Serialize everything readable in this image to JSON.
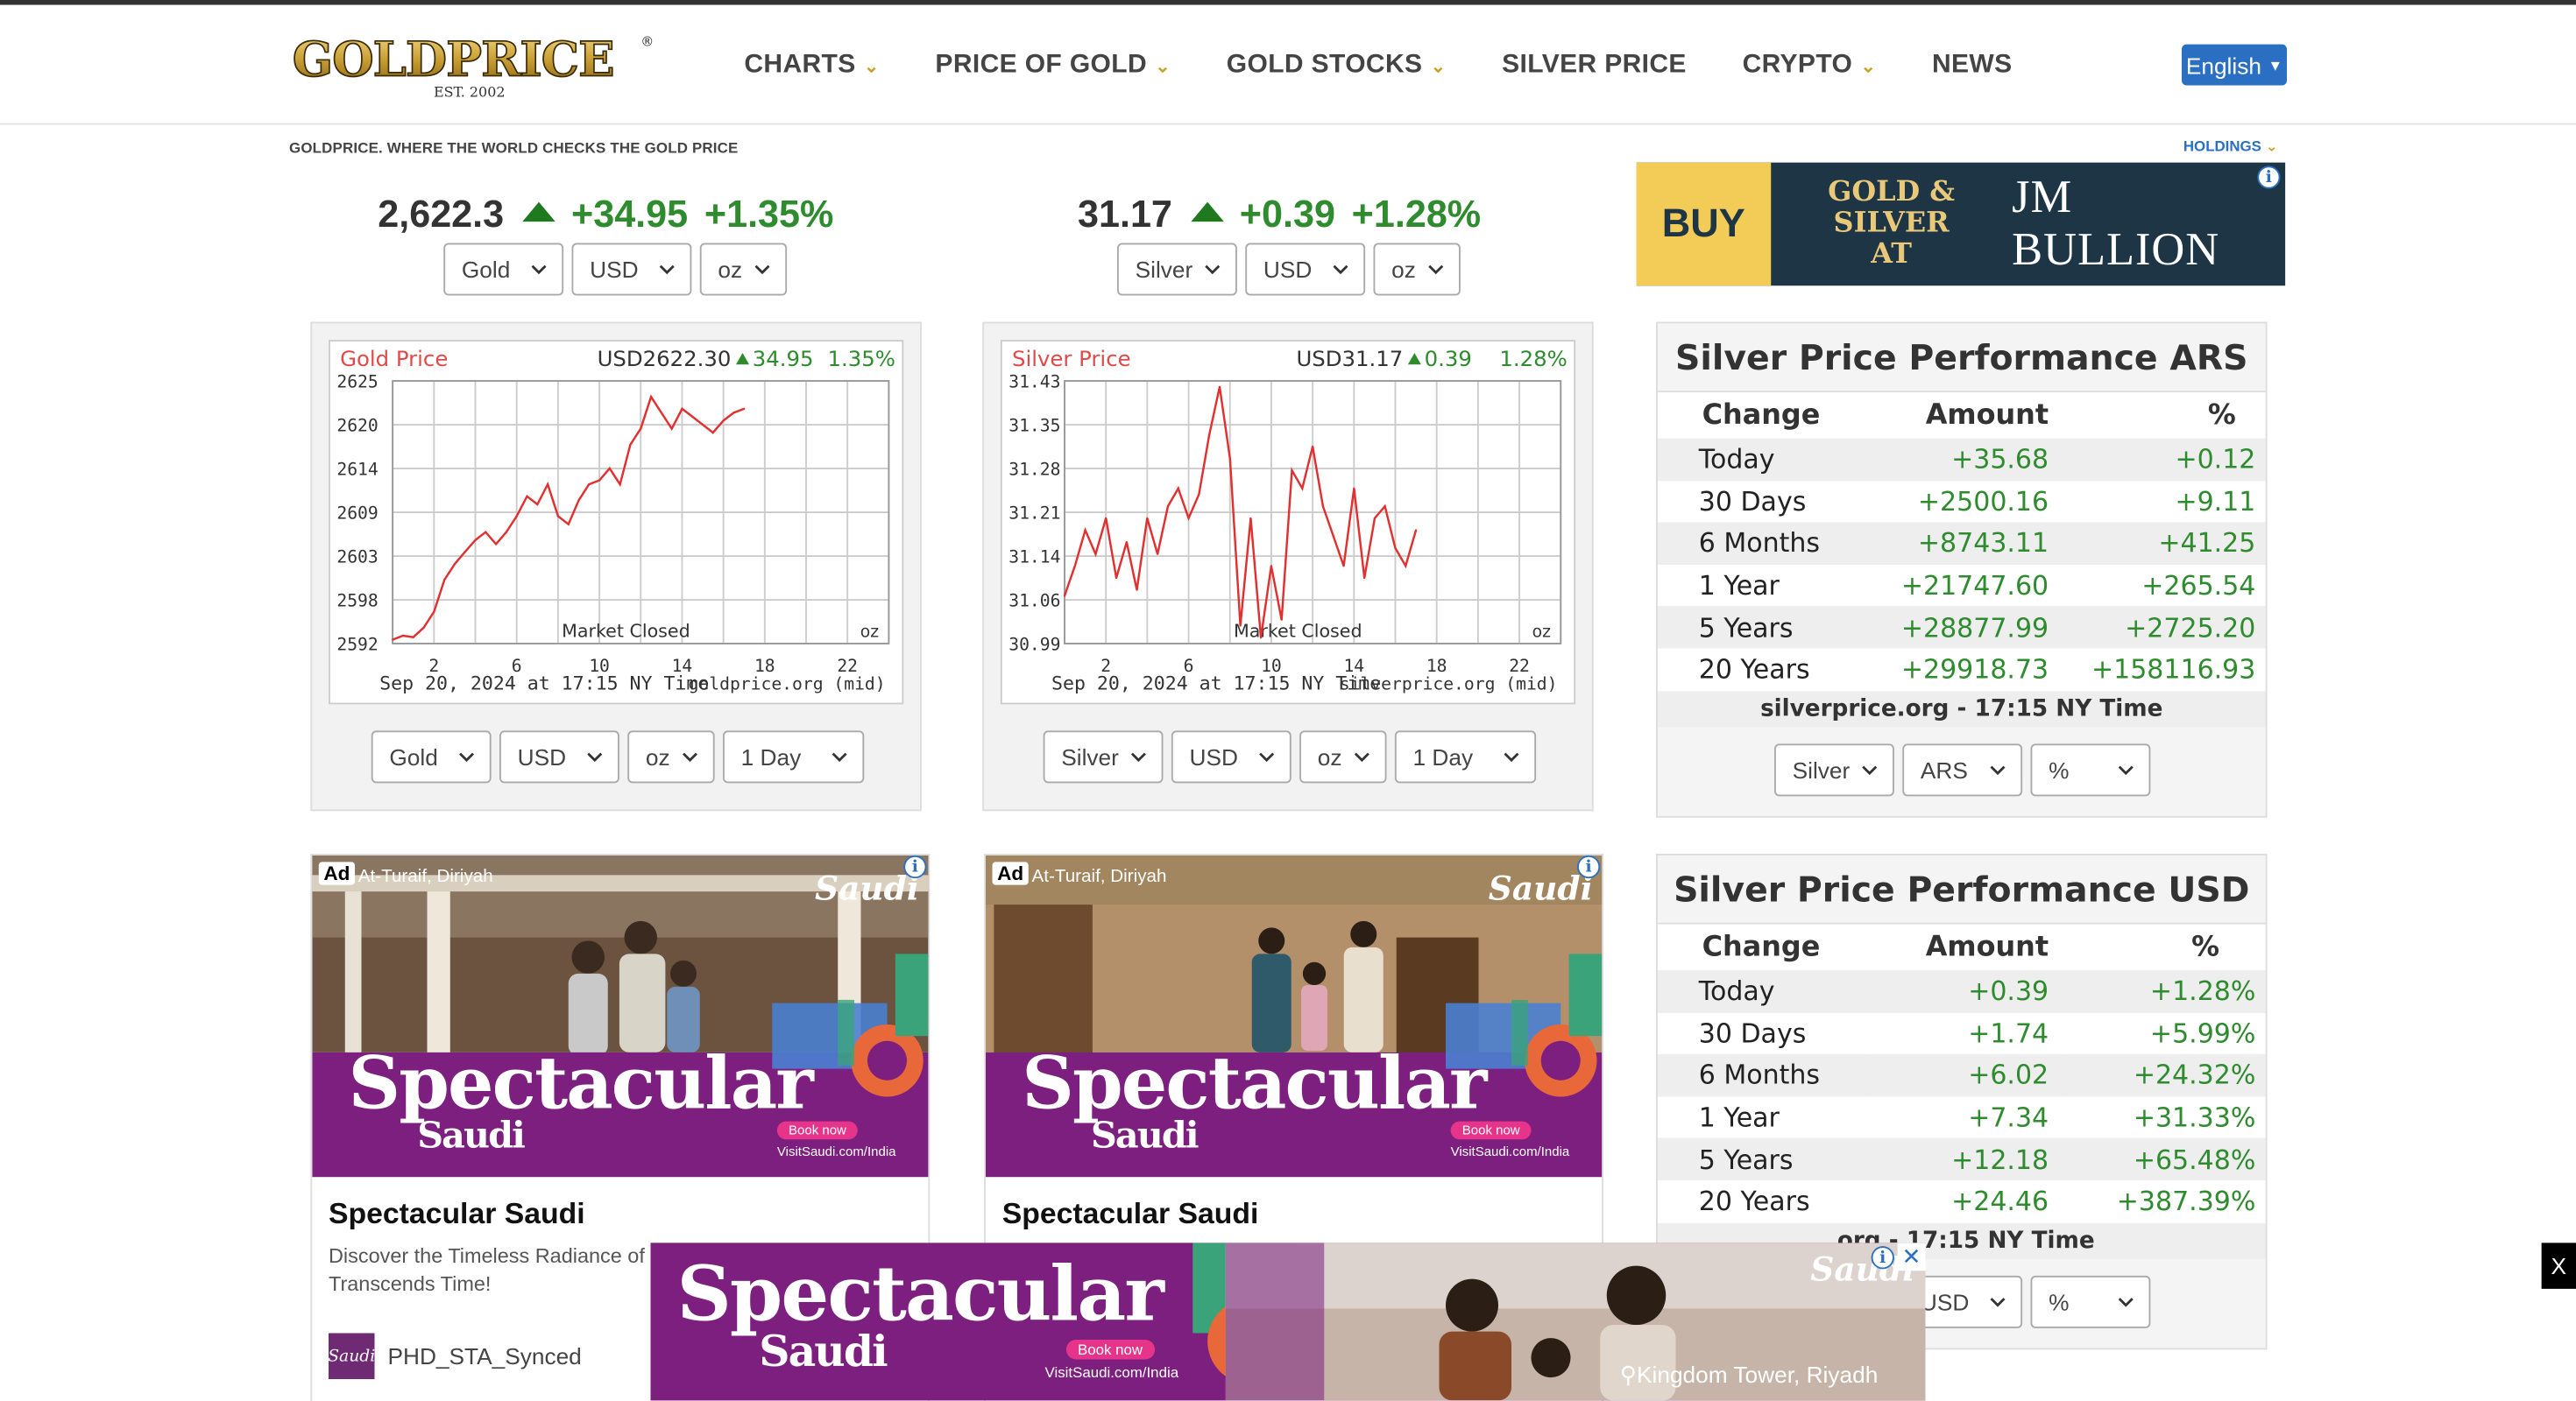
{
  "header": {
    "logo_text": "GOLDPRICE",
    "logo_est": "EST. 2002",
    "nav": [
      {
        "label": "CHARTS",
        "dropdown": true
      },
      {
        "label": "PRICE OF GOLD",
        "dropdown": true
      },
      {
        "label": "GOLD STOCKS",
        "dropdown": true
      },
      {
        "label": "SILVER PRICE",
        "dropdown": false
      },
      {
        "label": "CRYPTO",
        "dropdown": true
      },
      {
        "label": "NEWS",
        "dropdown": false
      }
    ],
    "language": "English",
    "tagline": "GOLDPRICE. WHERE THE WORLD CHECKS THE GOLD PRICE",
    "holdings": "HOLDINGS"
  },
  "gold_ticker": {
    "price": "2,622.3",
    "change": "+34.95",
    "percent": "+1.35%",
    "selects": [
      "Gold",
      "USD",
      "oz"
    ]
  },
  "silver_ticker": {
    "price": "31.17",
    "change": "+0.39",
    "percent": "+1.28%",
    "selects": [
      "Silver",
      "USD",
      "oz"
    ]
  },
  "top_ad": {
    "buy": "BUY",
    "line1": "GOLD &",
    "line2": "SILVER AT",
    "brand": "JM BULLION"
  },
  "gold_chart": {
    "title": "Gold Price",
    "headline_price": "USD2622.30",
    "headline_change": "34.95",
    "headline_pct": "1.35%",
    "market_status": "Market Closed",
    "unit": "oz",
    "timestamp": "Sep 20, 2024 at 17:15 NY Time",
    "source": "goldprice.org (mid)",
    "selects": [
      "Gold",
      "USD",
      "oz",
      "1 Day"
    ]
  },
  "silver_chart": {
    "title": "Silver Price",
    "headline_price": "USD31.17",
    "headline_change": "0.39",
    "headline_pct": "1.28%",
    "market_status": "Market Closed",
    "unit": "oz",
    "timestamp": "Sep 20, 2024 at 17:15 NY Time",
    "source": "silverprice.org (mid)",
    "selects": [
      "Silver",
      "USD",
      "oz",
      "1 Day"
    ]
  },
  "chart_data": [
    {
      "type": "line",
      "title": "Gold Price",
      "x_ticks": [
        "2",
        "6",
        "10",
        "14",
        "18",
        "22"
      ],
      "y_ticks": [
        "2625",
        "2620",
        "2614",
        "2609",
        "2603",
        "2598",
        "2592"
      ],
      "ylim": [
        2592,
        2625
      ],
      "xlim": [
        0,
        24
      ],
      "grid": true,
      "color": "#e03030",
      "series": [
        {
          "x": [
            0,
            0.5,
            1,
            1.5,
            2,
            2.5,
            3,
            3.5,
            4,
            4.5,
            5,
            5.5,
            6,
            6.5,
            7,
            7.5,
            8,
            8.5,
            9,
            9.5,
            10,
            10.5,
            11,
            11.5,
            12,
            12.5,
            13,
            13.5,
            14,
            14.5,
            15,
            15.5,
            16,
            16.5,
            17
          ],
          "y": [
            2592.5,
            2593,
            2592.8,
            2594,
            2596,
            2600,
            2602,
            2603.5,
            2605,
            2606,
            2604.5,
            2606,
            2608,
            2610.5,
            2609.5,
            2612,
            2608,
            2607,
            2610,
            2612,
            2612.5,
            2614,
            2612,
            2617,
            2619,
            2623,
            2621,
            2619,
            2621.5,
            2620.5,
            2619.5,
            2618.5,
            2620,
            2621,
            2621.5
          ]
        }
      ]
    },
    {
      "type": "line",
      "title": "Silver Price",
      "x_ticks": [
        "2",
        "6",
        "10",
        "14",
        "18",
        "22"
      ],
      "y_ticks": [
        "31.43",
        "31.35",
        "31.28",
        "31.21",
        "31.14",
        "31.06",
        "30.99"
      ],
      "ylim": [
        30.99,
        31.43
      ],
      "xlim": [
        0,
        24
      ],
      "grid": true,
      "color": "#e03030",
      "series": [
        {
          "x": [
            0,
            0.5,
            1,
            1.5,
            2,
            2.5,
            3,
            3.5,
            4,
            4.5,
            5,
            5.5,
            6,
            6.5,
            7,
            7.5,
            8,
            8.5,
            9,
            9.5,
            10,
            10.5,
            11,
            11.5,
            12,
            12.5,
            13,
            13.5,
            14,
            14.5,
            15,
            15.5,
            16,
            16.5,
            17
          ],
          "y": [
            31.07,
            31.12,
            31.18,
            31.14,
            31.2,
            31.1,
            31.16,
            31.08,
            31.2,
            31.14,
            31.22,
            31.25,
            31.2,
            31.24,
            31.34,
            31.42,
            31.3,
            31.02,
            31.2,
            31.0,
            31.12,
            31.03,
            31.28,
            31.25,
            31.32,
            31.22,
            31.17,
            31.12,
            31.25,
            31.1,
            31.2,
            31.22,
            31.15,
            31.12,
            31.18
          ]
        }
      ]
    }
  ],
  "perf_ars": {
    "title": "Silver Price Performance ARS",
    "headers": [
      "Change",
      "Amount",
      "%"
    ],
    "rows": [
      [
        "Today",
        "+35.68",
        "+0.12"
      ],
      [
        "30 Days",
        "+2500.16",
        "+9.11"
      ],
      [
        "6 Months",
        "+8743.11",
        "+41.25"
      ],
      [
        "1 Year",
        "+21747.60",
        "+265.54"
      ],
      [
        "5 Years",
        "+28877.99",
        "+2725.20"
      ],
      [
        "20 Years",
        "+29918.73",
        "+158116.93"
      ]
    ],
    "footer": "silverprice.org - 17:15 NY Time",
    "selects": [
      "Silver",
      "ARS",
      "%"
    ]
  },
  "perf_usd": {
    "title": "Silver Price Performance USD",
    "headers": [
      "Change",
      "Amount",
      "%"
    ],
    "rows": [
      [
        "Today",
        "+0.39",
        "+1.28%"
      ],
      [
        "30 Days",
        "+1.74",
        "+5.99%"
      ],
      [
        "6 Months",
        "+6.02",
        "+24.32%"
      ],
      [
        "1 Year",
        "+7.34",
        "+31.33%"
      ],
      [
        "5 Years",
        "+12.18",
        "+65.48%"
      ],
      [
        "20 Years",
        "+24.46",
        "+387.39%"
      ]
    ],
    "footer": ".org - 17:15 NY Time",
    "selects": [
      "USD",
      "%"
    ]
  },
  "ad_cards": [
    {
      "badge": "Ad",
      "location": "At-Turaif, Diriyah",
      "headline": "Spectacular",
      "sub": "Saudi",
      "cta": "Book now",
      "url": "VisitSaudi.com/India",
      "title": "Spectacular Saudi",
      "desc": "Discover the Timeless Radiance of",
      "desc2": "Transcends Time!",
      "brand": "PHD_STA_Synced",
      "logo": "Saudi"
    },
    {
      "badge": "Ad",
      "location": "At-Turaif, Diriyah",
      "headline": "Spectacular",
      "sub": "Saudi",
      "cta": "Book now",
      "url": "VisitSaudi.com/India",
      "title": "Spectacular Saudi",
      "logo": "Saudi"
    }
  ],
  "bottom_ad": {
    "headline": "Spectacular",
    "sub": "Saudi",
    "cta": "Book now",
    "url": "VisitSaudi.com/India",
    "location": "Kingdom Tower, Riyadh",
    "logo": "Saudi"
  },
  "close_label": "X"
}
